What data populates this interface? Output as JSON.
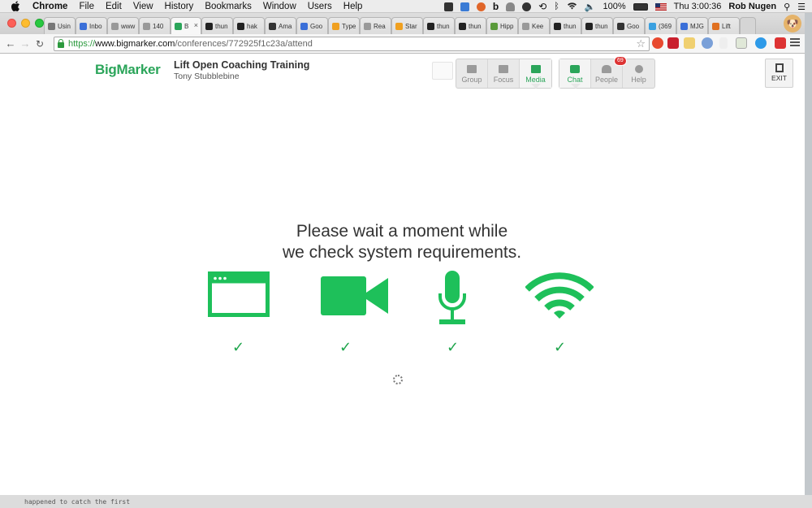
{
  "menubar": {
    "app_name": "Chrome",
    "menus": [
      "File",
      "Edit",
      "View",
      "History",
      "Bookmarks",
      "Window",
      "Users",
      "Help"
    ],
    "battery": "100%",
    "clock": "Thu 3:00:36",
    "user": "Rob Nugen"
  },
  "tabs": [
    {
      "label": "Usin",
      "color": "#777"
    },
    {
      "label": "Inbo",
      "color": "#3a6fd8"
    },
    {
      "label": "www",
      "color": "#999"
    },
    {
      "label": "140",
      "color": "#999"
    },
    {
      "label": "B",
      "color": "#2ba55a",
      "active": true
    },
    {
      "label": "thun",
      "color": "#222"
    },
    {
      "label": "hak",
      "color": "#222"
    },
    {
      "label": "Ama",
      "color": "#333"
    },
    {
      "label": "Goo",
      "color": "#3a6fd8"
    },
    {
      "label": "Type",
      "color": "#f0a020"
    },
    {
      "label": "Rea",
      "color": "#999"
    },
    {
      "label": "Star",
      "color": "#f0a020"
    },
    {
      "label": "thun",
      "color": "#222"
    },
    {
      "label": "thun",
      "color": "#222"
    },
    {
      "label": "Hipp",
      "color": "#5a9a3a"
    },
    {
      "label": "Kee",
      "color": "#999"
    },
    {
      "label": "thun",
      "color": "#222"
    },
    {
      "label": "thun",
      "color": "#222"
    },
    {
      "label": "Goo",
      "color": "#333"
    },
    {
      "label": "(369",
      "color": "#3aa0e0"
    },
    {
      "label": "MJG",
      "color": "#3a6fd8"
    },
    {
      "label": "Lift",
      "color": "#e07020"
    }
  ],
  "address": {
    "scheme": "https://",
    "host": "www.bigmarker.com",
    "path": "/conferences/772925f1c23a/attend"
  },
  "app": {
    "logo": "BigMarker",
    "title": "Lift Open Coaching Training",
    "host": "Tony Stubblebine"
  },
  "view_modes": [
    {
      "label": "Group",
      "active": false
    },
    {
      "label": "Focus",
      "active": false
    },
    {
      "label": "Media",
      "active": true
    }
  ],
  "panels": [
    {
      "label": "Chat",
      "active": true
    },
    {
      "label": "People",
      "badge": "69"
    },
    {
      "label": "Help"
    }
  ],
  "exit_label": "EXIT",
  "headline_line1": "Please wait a moment while",
  "headline_line2": "we check system requirements.",
  "checks": [
    {
      "icon": "browser-icon",
      "status": "✓"
    },
    {
      "icon": "video-camera-icon",
      "status": "✓"
    },
    {
      "icon": "microphone-icon",
      "status": "✓"
    },
    {
      "icon": "wifi-icon",
      "status": "✓"
    }
  ],
  "accent_color": "#1ea54c",
  "desktop_caption": "happened to catch the first"
}
